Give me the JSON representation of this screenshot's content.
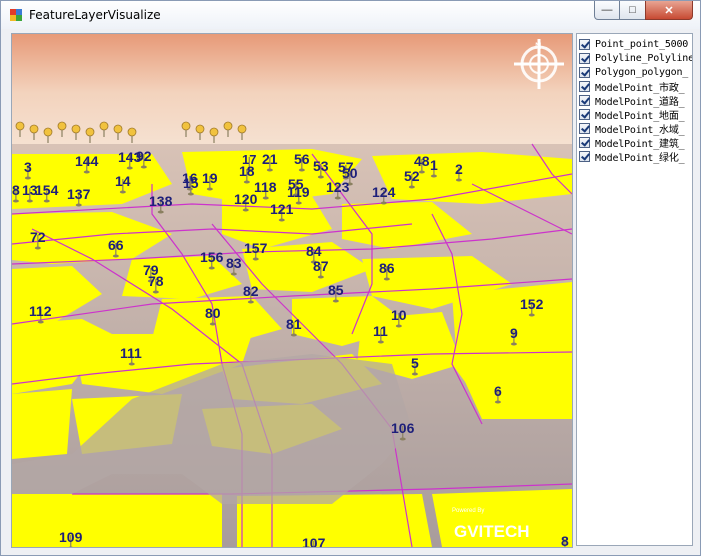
{
  "window": {
    "title": "FeatureLayerVisualize"
  },
  "controls": {
    "minimize": "—",
    "maximize": "□",
    "close": "✕"
  },
  "layers": [
    {
      "label": "Point_point_5000",
      "checked": true
    },
    {
      "label": "Polyline_Polyline",
      "checked": true
    },
    {
      "label": "Polygon_polygon_",
      "checked": true
    },
    {
      "label": "ModelPoint_市政_",
      "checked": true
    },
    {
      "label": "ModelPoint_道路_",
      "checked": true
    },
    {
      "label": "ModelPoint_地面_",
      "checked": true
    },
    {
      "label": "ModelPoint_水域_",
      "checked": true
    },
    {
      "label": "ModelPoint_建筑_",
      "checked": true
    },
    {
      "label": "ModelPoint_绿化_",
      "checked": true
    }
  ],
  "map": {
    "colors": {
      "sky_top": "#e9a78a",
      "sky_mid": "#f2d8c4",
      "ground": "#b9a9a4",
      "polygon": "#ffff00",
      "road": "#cc33cc",
      "label": "#1d1f7a"
    },
    "compass_icon": "compass-icon",
    "watermark": {
      "powered": "Powered By",
      "brand": "GVITECH"
    },
    "labels": [
      "3",
      "144",
      "143",
      "92",
      "2",
      "1",
      "48",
      "52",
      "57",
      "53",
      "56",
      "17",
      "21",
      "18",
      "16",
      "15",
      "19",
      "55",
      "50",
      "123",
      "124",
      "120",
      "118",
      "119",
      "121",
      "138",
      "137",
      "14",
      "154",
      "13",
      "8",
      "72",
      "66",
      "157",
      "84",
      "156",
      "83",
      "79",
      "78",
      "87",
      "86",
      "85",
      "112",
      "80",
      "82",
      "81",
      "10",
      "11",
      "152",
      "9",
      "111",
      "5",
      "6",
      "106",
      "109",
      "107",
      "8"
    ]
  }
}
